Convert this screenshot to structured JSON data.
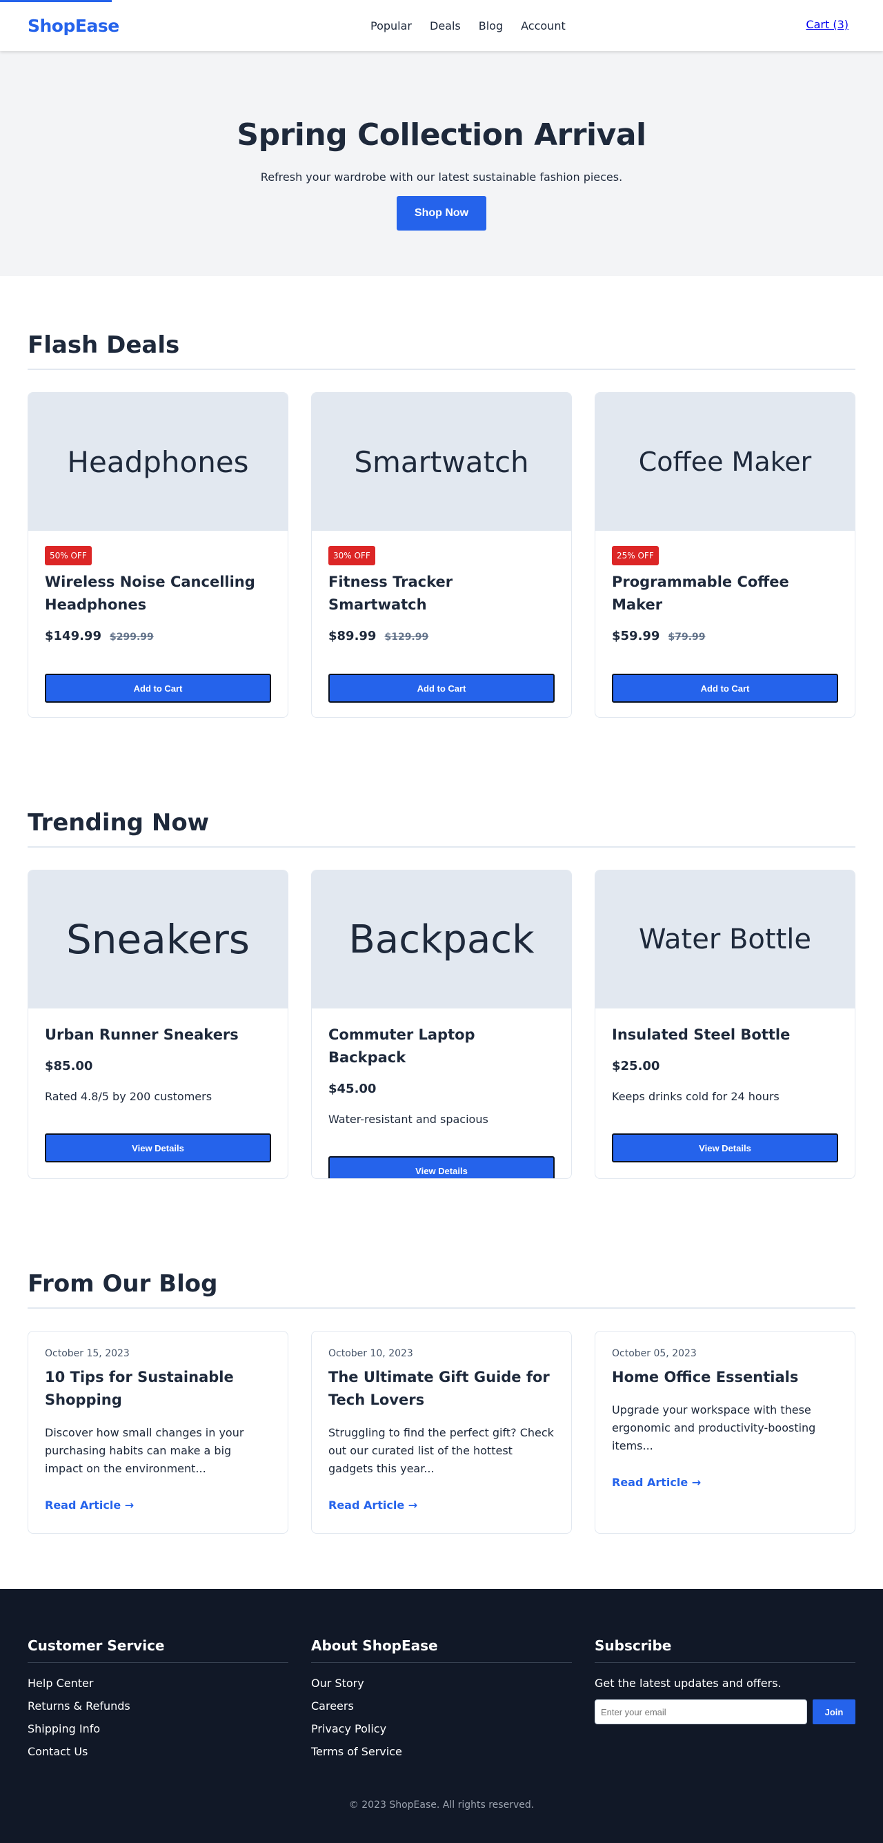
{
  "header": {
    "logo": "ShopEase",
    "nav": [
      "Popular",
      "Deals",
      "Blog",
      "Account"
    ],
    "cart": "Cart (3)"
  },
  "hero": {
    "title": "Spring Collection Arrival",
    "subtitle": "Refresh your wardrobe with our latest sustainable fashion pieces.",
    "cta": "Shop Now"
  },
  "flash": {
    "title": "Flash Deals",
    "items": [
      {
        "image": "Headphones",
        "badge": "50% OFF",
        "title": "Wireless Noise Cancelling Headphones",
        "price": "$149.99",
        "old_price": "$299.99",
        "cta": "Add to Cart"
      },
      {
        "image": "Smartwatch",
        "badge": "30% OFF",
        "title": "Fitness Tracker Smartwatch",
        "price": "$89.99",
        "old_price": "$129.99",
        "cta": "Add to Cart"
      },
      {
        "image": "Coffee Maker",
        "badge": "25% OFF",
        "title": "Programmable Coffee Maker",
        "price": "$59.99",
        "old_price": "$79.99",
        "cta": "Add to Cart"
      }
    ]
  },
  "trending": {
    "title": "Trending Now",
    "items": [
      {
        "image": "Sneakers",
        "title": "Urban Runner Sneakers",
        "price": "$85.00",
        "desc": "Rated 4.8/5 by 200 customers",
        "cta": "View Details"
      },
      {
        "image": "Backpack",
        "title": "Commuter Laptop Backpack",
        "price": "$45.00",
        "desc": "Water-resistant and spacious",
        "cta": "View Details"
      },
      {
        "image": "Water Bottle",
        "title": "Insulated Steel Bottle",
        "price": "$25.00",
        "desc": "Keeps drinks cold for 24 hours",
        "cta": "View Details"
      }
    ]
  },
  "blog": {
    "title": "From Our Blog",
    "posts": [
      {
        "date": "October 15, 2023",
        "title": "10 Tips for Sustainable Shopping",
        "excerpt": "Discover how small changes in your purchasing habits can make a big impact on the environment...",
        "link": "Read Article →"
      },
      {
        "date": "October 10, 2023",
        "title": "The Ultimate Gift Guide for Tech Lovers",
        "excerpt": "Struggling to find the perfect gift? Check out our curated list of the hottest gadgets this year...",
        "link": "Read Article →"
      },
      {
        "date": "October 05, 2023",
        "title": "Home Office Essentials",
        "excerpt": "Upgrade your workspace with these ergonomic and productivity-boosting items...",
        "link": "Read Article →"
      }
    ]
  },
  "footer": {
    "customer_service": {
      "title": "Customer Service",
      "links": [
        "Help Center",
        "Returns & Refunds",
        "Shipping Info",
        "Contact Us"
      ]
    },
    "about": {
      "title": "About ShopEase",
      "links": [
        "Our Story",
        "Careers",
        "Privacy Policy",
        "Terms of Service"
      ]
    },
    "subscribe": {
      "title": "Subscribe",
      "text": "Get the latest updates and offers.",
      "placeholder": "Enter your email",
      "button": "Join"
    },
    "copyright": "© 2023 ShopEase. All rights reserved."
  },
  "colors": {
    "accent": "#2563eb",
    "badge": "#dc2626",
    "footer_bg": "#111827"
  }
}
